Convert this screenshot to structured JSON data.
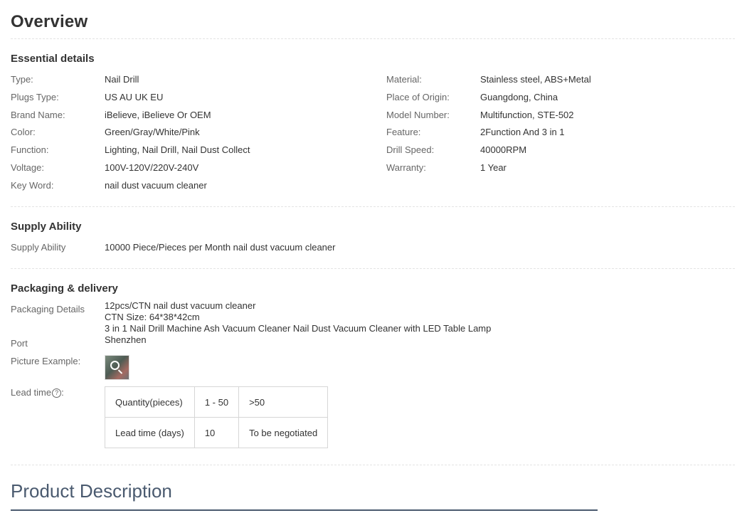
{
  "overview": {
    "title": "Overview"
  },
  "essential": {
    "title": "Essential details",
    "left": [
      {
        "label": "Type:",
        "value": "Nail Drill"
      },
      {
        "label": "Plugs Type:",
        "value": "US AU UK EU"
      },
      {
        "label": "Brand Name:",
        "value": "iBelieve, iBelieve Or OEM"
      },
      {
        "label": "Color:",
        "value": "Green/Gray/White/Pink"
      },
      {
        "label": "Function:",
        "value": "Lighting, Nail Drill, Nail Dust Collect"
      },
      {
        "label": "Voltage:",
        "value": "100V-120V/220V-240V"
      },
      {
        "label": "Key Word:",
        "value": "nail dust vacuum cleaner"
      }
    ],
    "right": [
      {
        "label": "Material:",
        "value": "Stainless steel, ABS+Metal"
      },
      {
        "label": "Place of Origin:",
        "value": "Guangdong, China"
      },
      {
        "label": "Model Number:",
        "value": "Multifunction, STE-502"
      },
      {
        "label": "Feature:",
        "value": "2Function And 3 in 1"
      },
      {
        "label": "Drill Speed:",
        "value": "40000RPM"
      },
      {
        "label": "Warranty:",
        "value": "1 Year"
      }
    ]
  },
  "supply": {
    "title": "Supply Ability",
    "label": "Supply Ability",
    "value": "10000 Piece/Pieces per Month nail dust vacuum cleaner"
  },
  "packaging": {
    "title": "Packaging & delivery",
    "details_label": "Packaging Details",
    "details_lines": [
      "12pcs/CTN nail dust vacuum cleaner",
      "CTN Size: 64*38*42cm",
      "3 in 1 Nail Drill Machine Ash Vacuum Cleaner Nail Dust Vacuum Cleaner with LED Table Lamp"
    ],
    "port_label": "Port",
    "port_value": "Shenzhen",
    "picture_label": "Picture Example:",
    "lead_label": "Lead time",
    "lead_suffix": ":",
    "help_glyph": "?",
    "lead_table": {
      "row1": [
        "Quantity(pieces)",
        "1 - 50",
        ">50"
      ],
      "row2": [
        "Lead time (days)",
        "10",
        "To be negotiated"
      ]
    }
  },
  "product_description": {
    "title": "Product Description"
  },
  "colors": {
    "text": "#333333",
    "label": "#666666",
    "divider": "#e3e3e3",
    "pd_title": "#4a5a6f"
  }
}
